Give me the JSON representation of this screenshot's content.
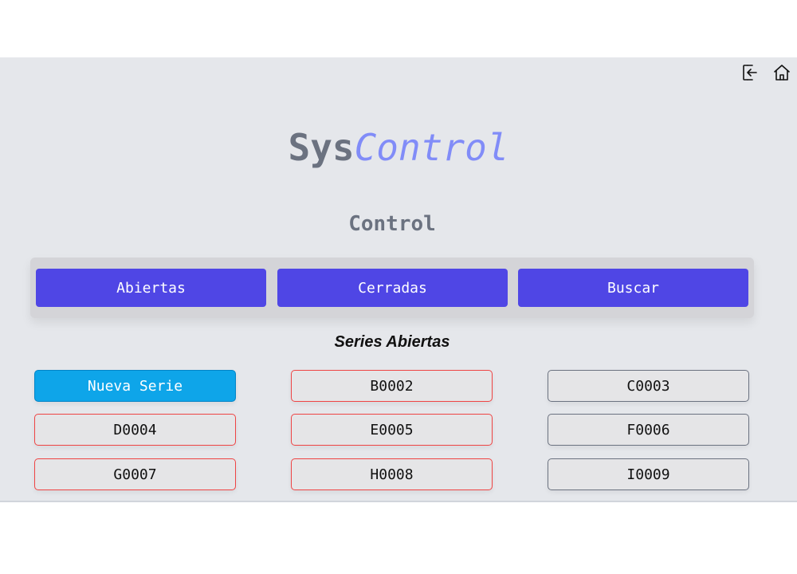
{
  "header": {
    "icons": [
      "logout-icon",
      "home-icon"
    ]
  },
  "brand": {
    "part1": "Sys",
    "part2": "Control"
  },
  "section_title": "Control",
  "tabs": [
    {
      "label": "Abiertas"
    },
    {
      "label": "Cerradas"
    },
    {
      "label": "Buscar"
    }
  ],
  "list_title": "Series Abiertas",
  "series": [
    {
      "label": "Nueva Serie"
    },
    {
      "label": "B0002"
    },
    {
      "label": "C0003"
    },
    {
      "label": "D0004"
    },
    {
      "label": "E0005"
    },
    {
      "label": "F0006"
    },
    {
      "label": "G0007"
    },
    {
      "label": "H0008"
    },
    {
      "label": "I0009"
    }
  ],
  "colors": {
    "accent": "#4f46e5",
    "new_button": "#0ea5e9",
    "border_red": "#ef4444",
    "border_gray": "#6b7280"
  }
}
